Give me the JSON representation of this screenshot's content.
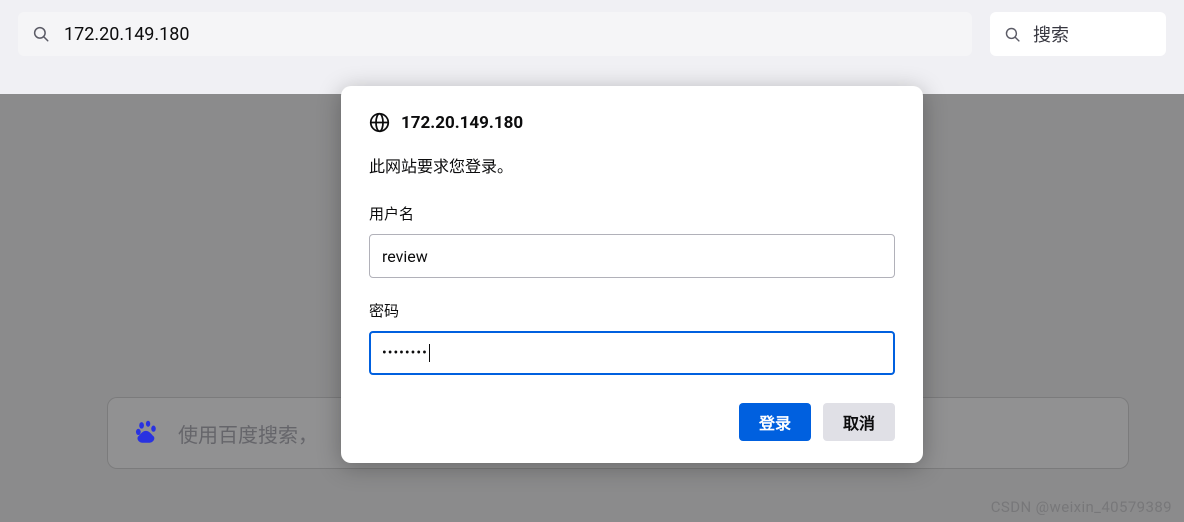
{
  "chrome": {
    "url": "172.20.149.180",
    "search_label": "搜索"
  },
  "baidu": {
    "placeholder": "使用百度搜索，"
  },
  "auth_dialog": {
    "host": "172.20.149.180",
    "message": "此网站要求您登录。",
    "username_label": "用户名",
    "password_label": "密码",
    "username_value": "review",
    "password_value": "••••••••",
    "login_button": "登录",
    "cancel_button": "取消"
  },
  "watermark": "CSDN @weixin_40579389"
}
